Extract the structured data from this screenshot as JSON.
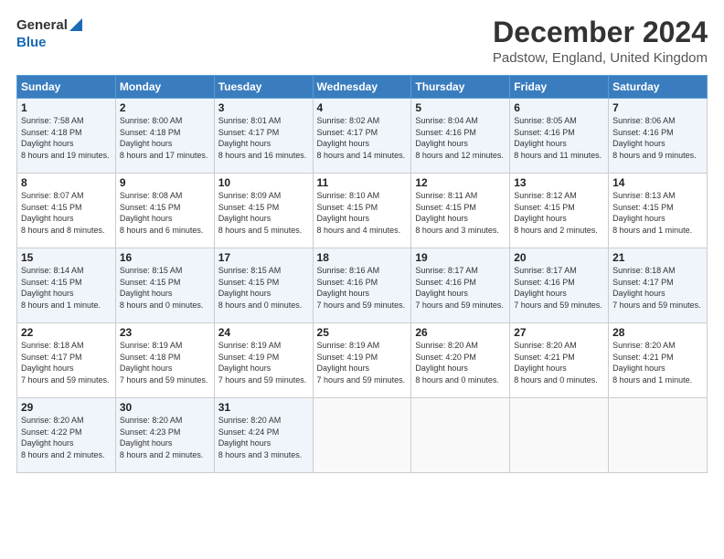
{
  "logo": {
    "general": "General",
    "blue": "Blue"
  },
  "title": "December 2024",
  "location": "Padstow, England, United Kingdom",
  "days_of_week": [
    "Sunday",
    "Monday",
    "Tuesday",
    "Wednesday",
    "Thursday",
    "Friday",
    "Saturday"
  ],
  "weeks": [
    [
      {
        "day": "1",
        "sunrise": "7:58 AM",
        "sunset": "4:18 PM",
        "daylight": "8 hours and 19 minutes."
      },
      {
        "day": "2",
        "sunrise": "8:00 AM",
        "sunset": "4:18 PM",
        "daylight": "8 hours and 17 minutes."
      },
      {
        "day": "3",
        "sunrise": "8:01 AM",
        "sunset": "4:17 PM",
        "daylight": "8 hours and 16 minutes."
      },
      {
        "day": "4",
        "sunrise": "8:02 AM",
        "sunset": "4:17 PM",
        "daylight": "8 hours and 14 minutes."
      },
      {
        "day": "5",
        "sunrise": "8:04 AM",
        "sunset": "4:16 PM",
        "daylight": "8 hours and 12 minutes."
      },
      {
        "day": "6",
        "sunrise": "8:05 AM",
        "sunset": "4:16 PM",
        "daylight": "8 hours and 11 minutes."
      },
      {
        "day": "7",
        "sunrise": "8:06 AM",
        "sunset": "4:16 PM",
        "daylight": "8 hours and 9 minutes."
      }
    ],
    [
      {
        "day": "8",
        "sunrise": "8:07 AM",
        "sunset": "4:15 PM",
        "daylight": "8 hours and 8 minutes."
      },
      {
        "day": "9",
        "sunrise": "8:08 AM",
        "sunset": "4:15 PM",
        "daylight": "8 hours and 6 minutes."
      },
      {
        "day": "10",
        "sunrise": "8:09 AM",
        "sunset": "4:15 PM",
        "daylight": "8 hours and 5 minutes."
      },
      {
        "day": "11",
        "sunrise": "8:10 AM",
        "sunset": "4:15 PM",
        "daylight": "8 hours and 4 minutes."
      },
      {
        "day": "12",
        "sunrise": "8:11 AM",
        "sunset": "4:15 PM",
        "daylight": "8 hours and 3 minutes."
      },
      {
        "day": "13",
        "sunrise": "8:12 AM",
        "sunset": "4:15 PM",
        "daylight": "8 hours and 2 minutes."
      },
      {
        "day": "14",
        "sunrise": "8:13 AM",
        "sunset": "4:15 PM",
        "daylight": "8 hours and 1 minute."
      }
    ],
    [
      {
        "day": "15",
        "sunrise": "8:14 AM",
        "sunset": "4:15 PM",
        "daylight": "8 hours and 1 minute."
      },
      {
        "day": "16",
        "sunrise": "8:15 AM",
        "sunset": "4:15 PM",
        "daylight": "8 hours and 0 minutes."
      },
      {
        "day": "17",
        "sunrise": "8:15 AM",
        "sunset": "4:15 PM",
        "daylight": "8 hours and 0 minutes."
      },
      {
        "day": "18",
        "sunrise": "8:16 AM",
        "sunset": "4:16 PM",
        "daylight": "7 hours and 59 minutes."
      },
      {
        "day": "19",
        "sunrise": "8:17 AM",
        "sunset": "4:16 PM",
        "daylight": "7 hours and 59 minutes."
      },
      {
        "day": "20",
        "sunrise": "8:17 AM",
        "sunset": "4:16 PM",
        "daylight": "7 hours and 59 minutes."
      },
      {
        "day": "21",
        "sunrise": "8:18 AM",
        "sunset": "4:17 PM",
        "daylight": "7 hours and 59 minutes."
      }
    ],
    [
      {
        "day": "22",
        "sunrise": "8:18 AM",
        "sunset": "4:17 PM",
        "daylight": "7 hours and 59 minutes."
      },
      {
        "day": "23",
        "sunrise": "8:19 AM",
        "sunset": "4:18 PM",
        "daylight": "7 hours and 59 minutes."
      },
      {
        "day": "24",
        "sunrise": "8:19 AM",
        "sunset": "4:19 PM",
        "daylight": "7 hours and 59 minutes."
      },
      {
        "day": "25",
        "sunrise": "8:19 AM",
        "sunset": "4:19 PM",
        "daylight": "7 hours and 59 minutes."
      },
      {
        "day": "26",
        "sunrise": "8:20 AM",
        "sunset": "4:20 PM",
        "daylight": "8 hours and 0 minutes."
      },
      {
        "day": "27",
        "sunrise": "8:20 AM",
        "sunset": "4:21 PM",
        "daylight": "8 hours and 0 minutes."
      },
      {
        "day": "28",
        "sunrise": "8:20 AM",
        "sunset": "4:21 PM",
        "daylight": "8 hours and 1 minute."
      }
    ],
    [
      {
        "day": "29",
        "sunrise": "8:20 AM",
        "sunset": "4:22 PM",
        "daylight": "8 hours and 2 minutes."
      },
      {
        "day": "30",
        "sunrise": "8:20 AM",
        "sunset": "4:23 PM",
        "daylight": "8 hours and 2 minutes."
      },
      {
        "day": "31",
        "sunrise": "8:20 AM",
        "sunset": "4:24 PM",
        "daylight": "8 hours and 3 minutes."
      },
      null,
      null,
      null,
      null
    ]
  ],
  "labels": {
    "sunrise": "Sunrise:",
    "sunset": "Sunset:",
    "daylight": "Daylight:"
  }
}
